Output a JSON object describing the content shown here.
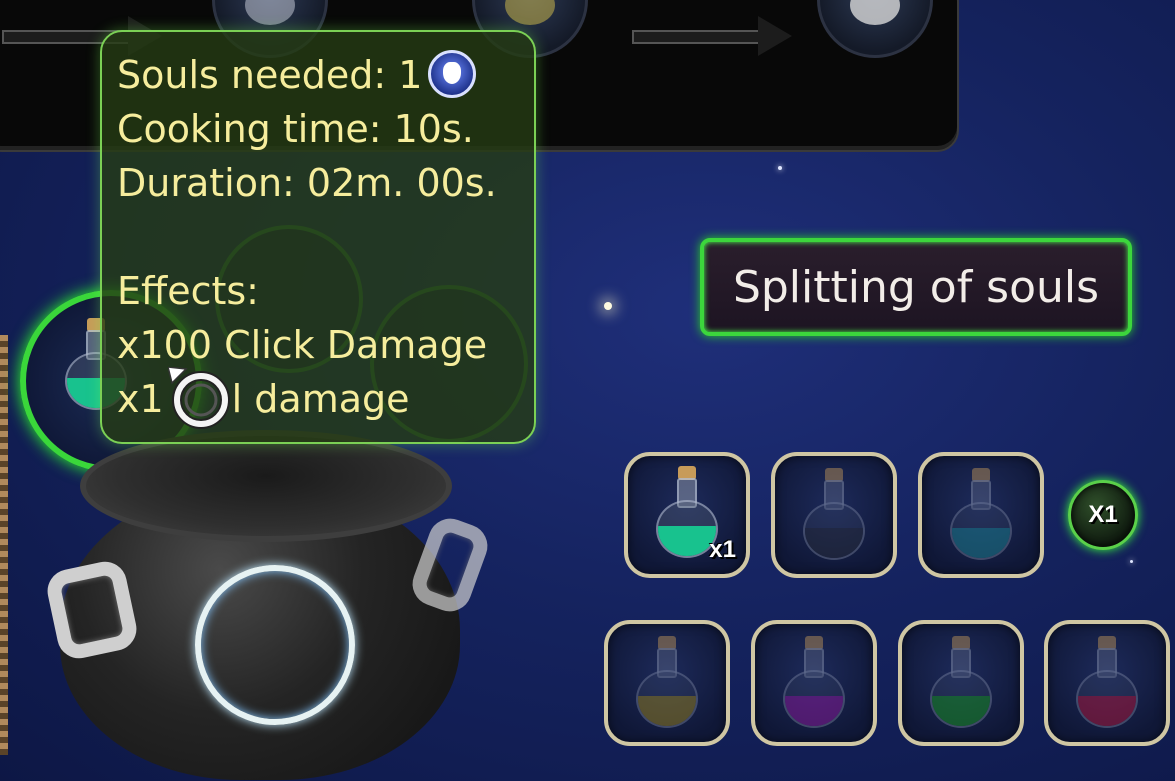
{
  "tooltip": {
    "souls_label": "Souls needed: 1",
    "cooking_time": "Cooking time: 10s.",
    "duration": "Duration: 02m. 00s.",
    "effects_title": "Effects:",
    "effect_1": "x100 Click Damage",
    "effect_2": "x1",
    "effect_2_tail": "l damage",
    "soul_icon": "soul-icon"
  },
  "recipe_name": "Splitting of souls",
  "multiplier_button": "X1",
  "slots_row1": [
    {
      "color": "#18c28e",
      "count": "x1"
    },
    {
      "color": "#2b2f3a",
      "count": ""
    },
    {
      "color": "#1d8f9c",
      "count": ""
    }
  ],
  "slots_row2": [
    {
      "color": "#a58c1a"
    },
    {
      "color": "#9a1aa8"
    },
    {
      "color": "#1aa31e"
    },
    {
      "color": "#c0163a"
    }
  ],
  "colors": {
    "tooltip_text": "#f6ed9d",
    "accent_green": "#3cd63c",
    "slot_border": "#cfc6a3"
  }
}
